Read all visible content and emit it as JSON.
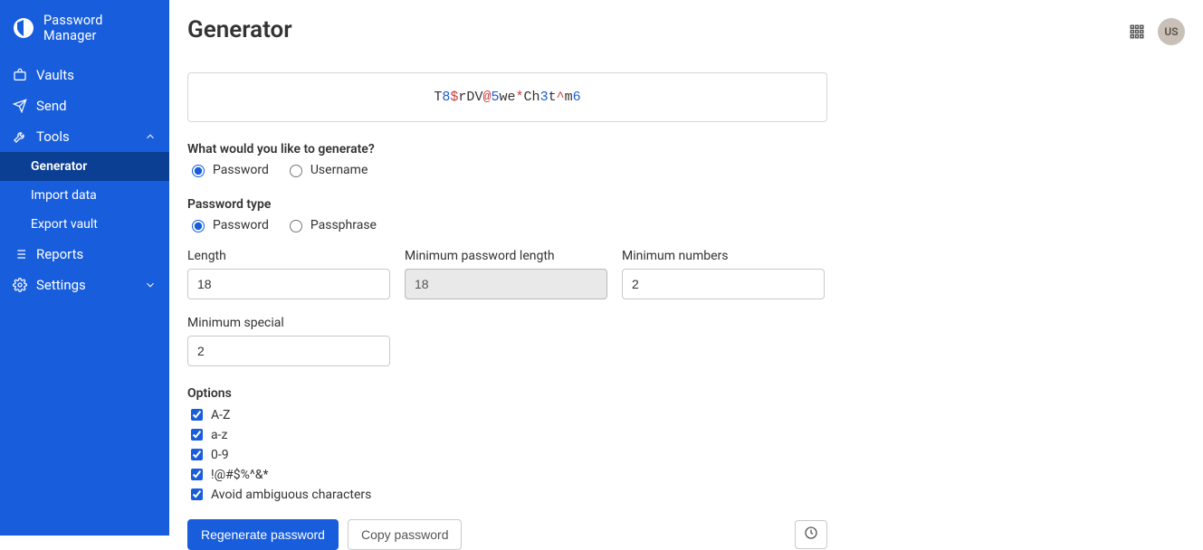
{
  "brand": {
    "name": "Password Manager"
  },
  "sidebar": {
    "items": [
      {
        "label": "Vaults"
      },
      {
        "label": "Send"
      },
      {
        "label": "Tools",
        "expanded": true
      },
      {
        "label": "Reports"
      },
      {
        "label": "Settings",
        "expanded": false
      }
    ],
    "tools_sub": [
      {
        "label": "Generator",
        "active": true
      },
      {
        "label": "Import data",
        "active": false
      },
      {
        "label": "Export vault",
        "active": false
      }
    ]
  },
  "header": {
    "title": "Generator",
    "avatar_initials": "US"
  },
  "generator": {
    "password_chars": [
      {
        "c": "T",
        "t": "letter"
      },
      {
        "c": "8",
        "t": "digit"
      },
      {
        "c": "$",
        "t": "special"
      },
      {
        "c": "r",
        "t": "letter"
      },
      {
        "c": "D",
        "t": "letter"
      },
      {
        "c": "V",
        "t": "letter"
      },
      {
        "c": "@",
        "t": "special"
      },
      {
        "c": "5",
        "t": "digit"
      },
      {
        "c": "w",
        "t": "letter"
      },
      {
        "c": "e",
        "t": "letter"
      },
      {
        "c": "*",
        "t": "special"
      },
      {
        "c": "C",
        "t": "letter"
      },
      {
        "c": "h",
        "t": "letter"
      },
      {
        "c": "3",
        "t": "digit"
      },
      {
        "c": "t",
        "t": "letter"
      },
      {
        "c": "^",
        "t": "special"
      },
      {
        "c": "m",
        "t": "letter"
      },
      {
        "c": "6",
        "t": "digit"
      }
    ],
    "what_label": "What would you like to generate?",
    "what_options": [
      {
        "label": "Password",
        "selected": true
      },
      {
        "label": "Username",
        "selected": false
      }
    ],
    "type_label": "Password type",
    "type_options": [
      {
        "label": "Password",
        "selected": true
      },
      {
        "label": "Passphrase",
        "selected": false
      }
    ],
    "fields": {
      "length": {
        "label": "Length",
        "value": "18",
        "disabled": false
      },
      "min_length": {
        "label": "Minimum password length",
        "value": "18",
        "disabled": true
      },
      "min_numbers": {
        "label": "Minimum numbers",
        "value": "2",
        "disabled": false
      },
      "min_special": {
        "label": "Minimum special",
        "value": "2",
        "disabled": false
      }
    },
    "options_label": "Options",
    "char_options": [
      {
        "label": "A-Z",
        "checked": true
      },
      {
        "label": "a-z",
        "checked": true
      },
      {
        "label": "0-9",
        "checked": true
      },
      {
        "label": "!@#$%^&*",
        "checked": true
      },
      {
        "label": "Avoid ambiguous characters",
        "checked": true
      }
    ],
    "buttons": {
      "regenerate": "Regenerate password",
      "copy": "Copy password"
    }
  }
}
